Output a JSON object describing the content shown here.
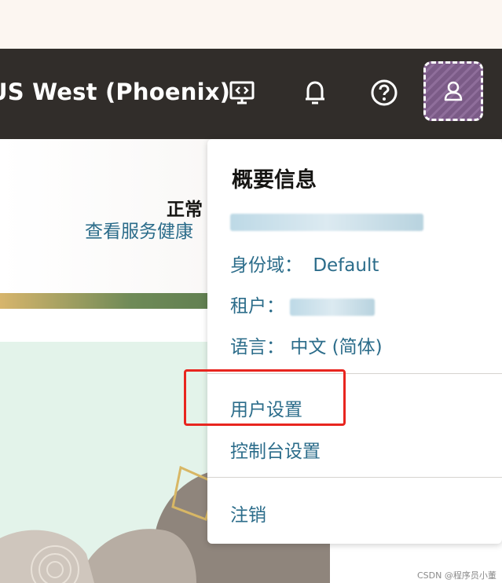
{
  "header": {
    "region_label": "US West (Phoenix)"
  },
  "status": {
    "title": "正常",
    "link": "查看服务健康"
  },
  "profile_menu": {
    "title": "概要信息",
    "username_redacted": "ute-deng@ .ro",
    "identity_domain_label": "身份域：",
    "identity_domain_value": "Default",
    "tenancy_label": "租户：",
    "tenancy_value_redacted": "dateng",
    "language_label": "语言：",
    "language_value": "中文 (简体)",
    "user_settings": "用户设置",
    "console_settings": "控制台设置",
    "sign_out": "注销"
  },
  "watermark": "CSDN @程序员小董",
  "colors": {
    "header_bg": "#312d2a",
    "link": "#2b6c8a",
    "highlight": "#e8251f",
    "avatar": "#7b5b87"
  }
}
